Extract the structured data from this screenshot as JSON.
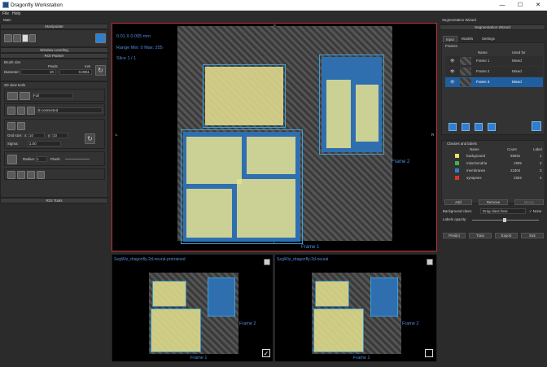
{
  "app": {
    "title": "Dragonfly Workstation",
    "min": "—",
    "max": "☐",
    "close": "✕"
  },
  "menu": {
    "file": "File",
    "help": "Help",
    "main": "Main"
  },
  "left": {
    "manipulate": "Manipulate",
    "window_leveling": "Window Leveling",
    "roi_painter": "ROI Painter",
    "brush_size": "Brush size",
    "pixels": "Pixels",
    "mm": "mm",
    "diameter_label": "Diameter:",
    "diameter_px": "20",
    "diameter_mm": "0.0051",
    "tools_2d": "2D view tools",
    "mode": "Full",
    "connect": "8-connected",
    "grid_size": "Grid size:",
    "x_label": "x:",
    "x_val": "10",
    "y_label": "y:",
    "y_val": "10",
    "sigma_label": "Sigma:",
    "sigma_val": "1.00",
    "radius_label": "Radius:",
    "radius_val": "1",
    "radius_unit": "Pixels",
    "roi_tools": "ROI Tools"
  },
  "view": {
    "scale_text": "0.01 X 0.005 mm",
    "range_text": "Range Min: 0 Max: 255",
    "slice_text": "Slice 1 / 1",
    "frame1": "Frame 1",
    "frame2": "Frame 2",
    "top_letter": "S",
    "left_letter": "L",
    "right_letter": "R",
    "bottom_letter": "I"
  },
  "bottom_views": [
    {
      "title": "SegWiz_dragonfly-2d-neural-pretrained",
      "frame1": "Frame 1",
      "frame2": "Frame 2",
      "checked": "✓"
    },
    {
      "title": "SegWiz_dragonfly-2d-neural",
      "frame1": "Frame 1",
      "frame2": "Frame 2",
      "checked": ""
    }
  ],
  "right": {
    "panel": "Segmentation Wizard",
    "header": "Segmentation Wizard",
    "tabs": [
      "Input",
      "Models",
      "Settings"
    ],
    "frames_title": "Frames",
    "frames_cols": [
      "Name",
      "Used for"
    ],
    "frames": [
      {
        "name": "Frame 1",
        "used": "Mixed"
      },
      {
        "name": "Frame 2",
        "used": "Mixed"
      },
      {
        "name": "Frame 3",
        "used": "Mixed"
      }
    ],
    "classes_title": "Classes and labels",
    "classes_cols": [
      "Name",
      "Count",
      "Label"
    ],
    "classes": [
      {
        "name": "background",
        "count": "55591",
        "label": "1",
        "color": "#e8e06a"
      },
      {
        "name": "mitochondria",
        "count": "1909",
        "label": "2",
        "color": "#3db34a"
      },
      {
        "name": "membranes",
        "count": "22304",
        "label": "3",
        "color": "#2f7fd0"
      },
      {
        "name": "synapses",
        "count": "1552",
        "label": "4",
        "color": "#e0332c"
      }
    ],
    "add": "Add",
    "remove": "Remove",
    "merge": "Merge",
    "bg_class_label": "Background class:",
    "bg_class_value": "Drag class here",
    "none": "None",
    "opacity_label": "Labels opacity:",
    "actions": [
      "Predict",
      "Train",
      "Export",
      "Exit"
    ]
  }
}
